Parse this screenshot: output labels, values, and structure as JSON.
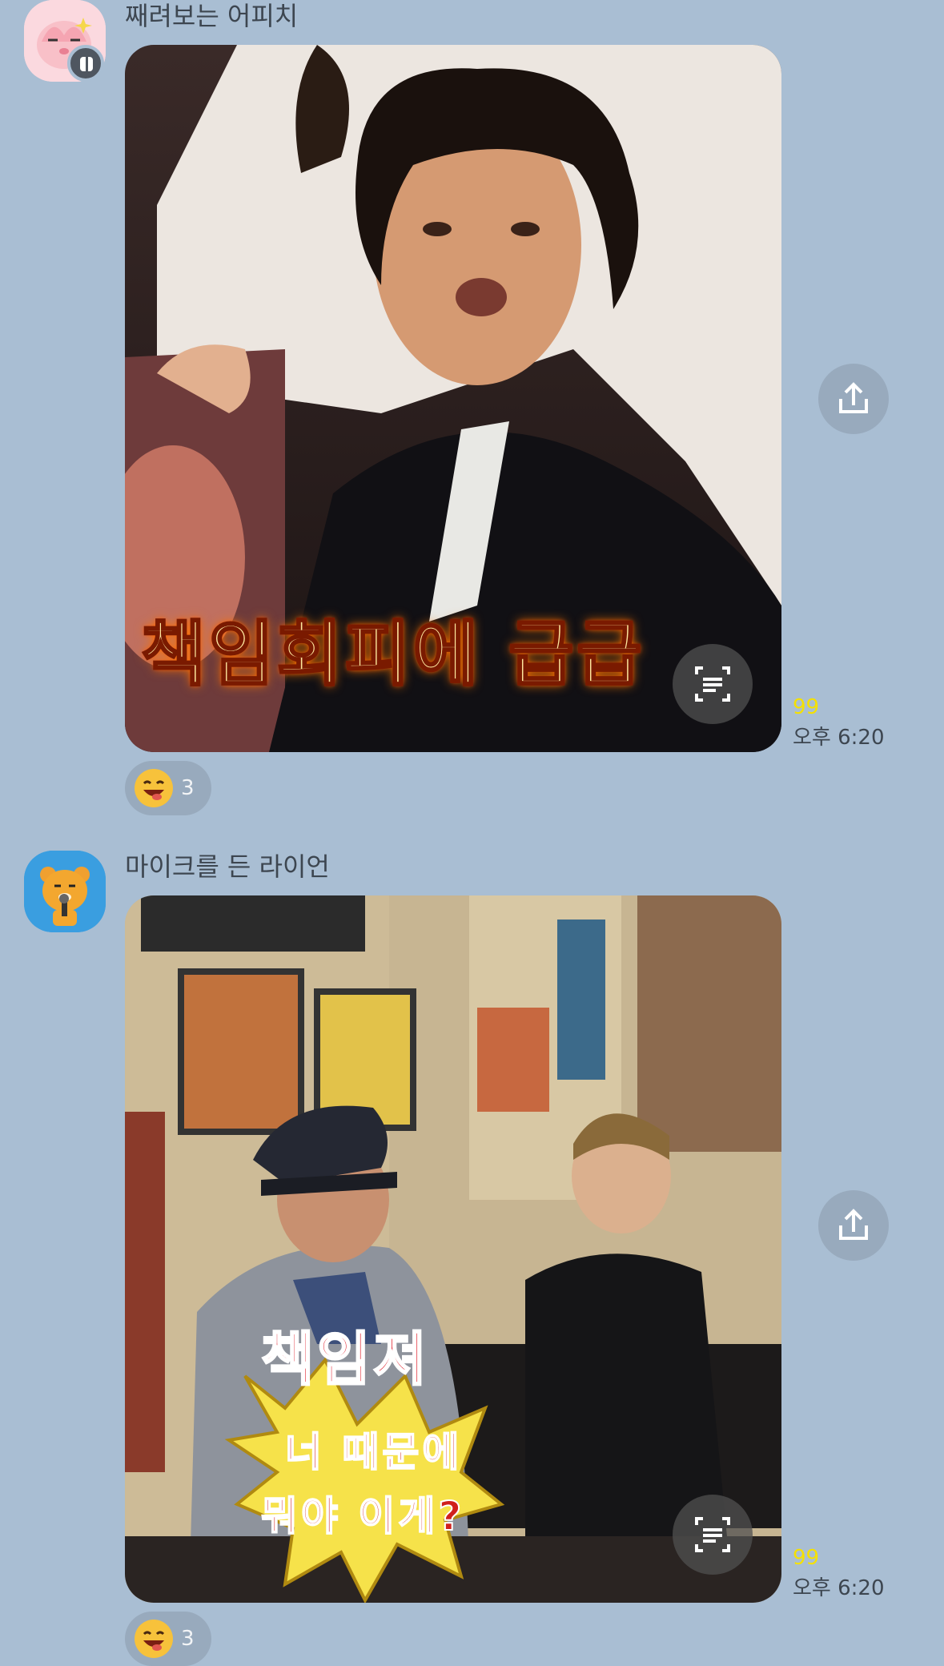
{
  "messages": [
    {
      "sender": "째려보는 어피치",
      "caption": "책임회피에 급급",
      "unread": "99",
      "time": "오후 6:20",
      "reaction_count": "3"
    },
    {
      "sender": "마이크를 든 라이언",
      "caption_title": "책임져",
      "caption_line1": "너 때문에",
      "caption_line2": "뭐야 이게?",
      "unread": "99",
      "time": "오후 6:20",
      "reaction_count": "3"
    }
  ]
}
